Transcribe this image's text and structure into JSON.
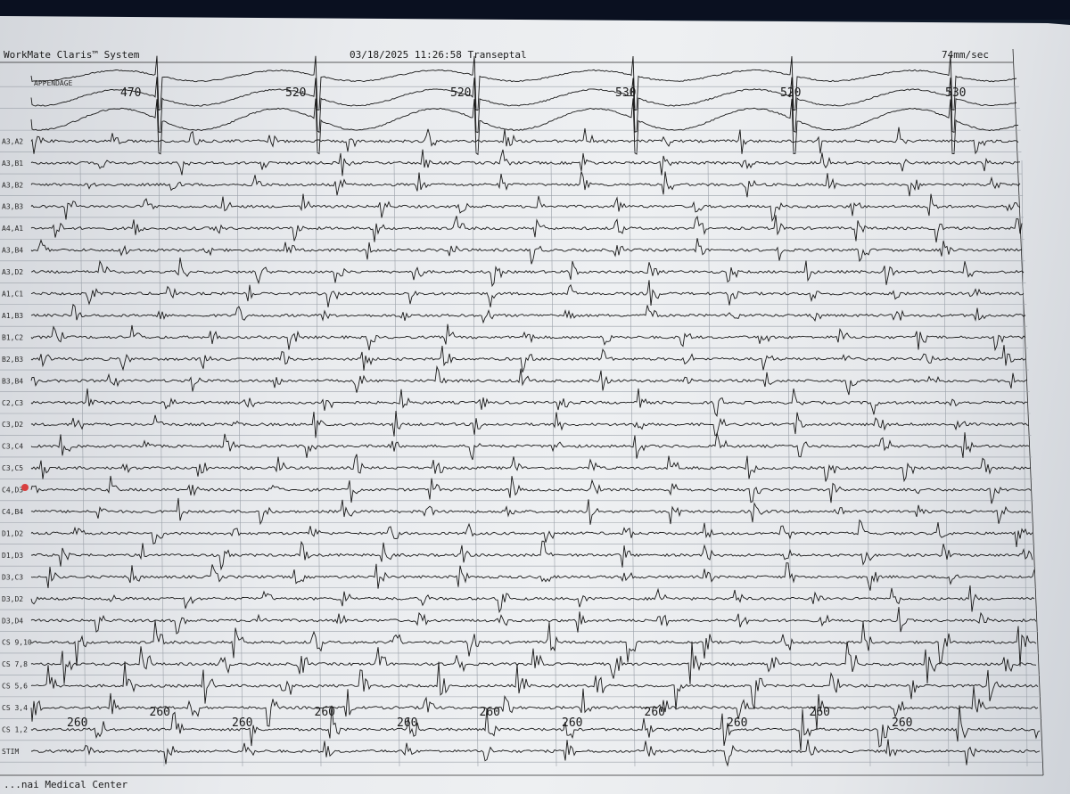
{
  "header": {
    "system_title": "WorkMate Claris™ System",
    "timestamp": "03/18/2025 11:26:58 Transeptal",
    "sweep_speed": "74mm/sec"
  },
  "footer": {
    "institution": "...nai Medical Center"
  },
  "top_label": "APPENDAGE",
  "channels": [
    "",
    "",
    "",
    "A3,A2",
    "A3,B1",
    "A3,B2",
    "A3,B3",
    "A4,A1",
    "A3,B4",
    "A3,D2",
    "A1,C1",
    "A1,B3",
    "B1,C2",
    "B2,B3",
    "B3,B4",
    "C2,C3",
    "C3,D2",
    "C3,C4",
    "C3,C5",
    "C4,D3",
    "C4,B4",
    "D1,D2",
    "D1,D3",
    "D3,C3",
    "D3,D2",
    "D3,D4",
    "CS 9,10",
    "CS 7,8",
    "CS 5,6",
    "CS 3,4",
    "CS 1,2",
    "STIM"
  ],
  "cycle_lengths_top": [
    "470",
    "520",
    "520",
    "530",
    "520",
    "530"
  ],
  "cycle_lengths_cs": [
    "260",
    "260",
    "260",
    "260",
    "260",
    "260",
    "260",
    "260",
    "260",
    "260",
    "260"
  ],
  "colors": {
    "screen": "#eceef0",
    "trace": "#1a1a1a",
    "bezel": "#101a2a",
    "marker": "#d94040"
  }
}
